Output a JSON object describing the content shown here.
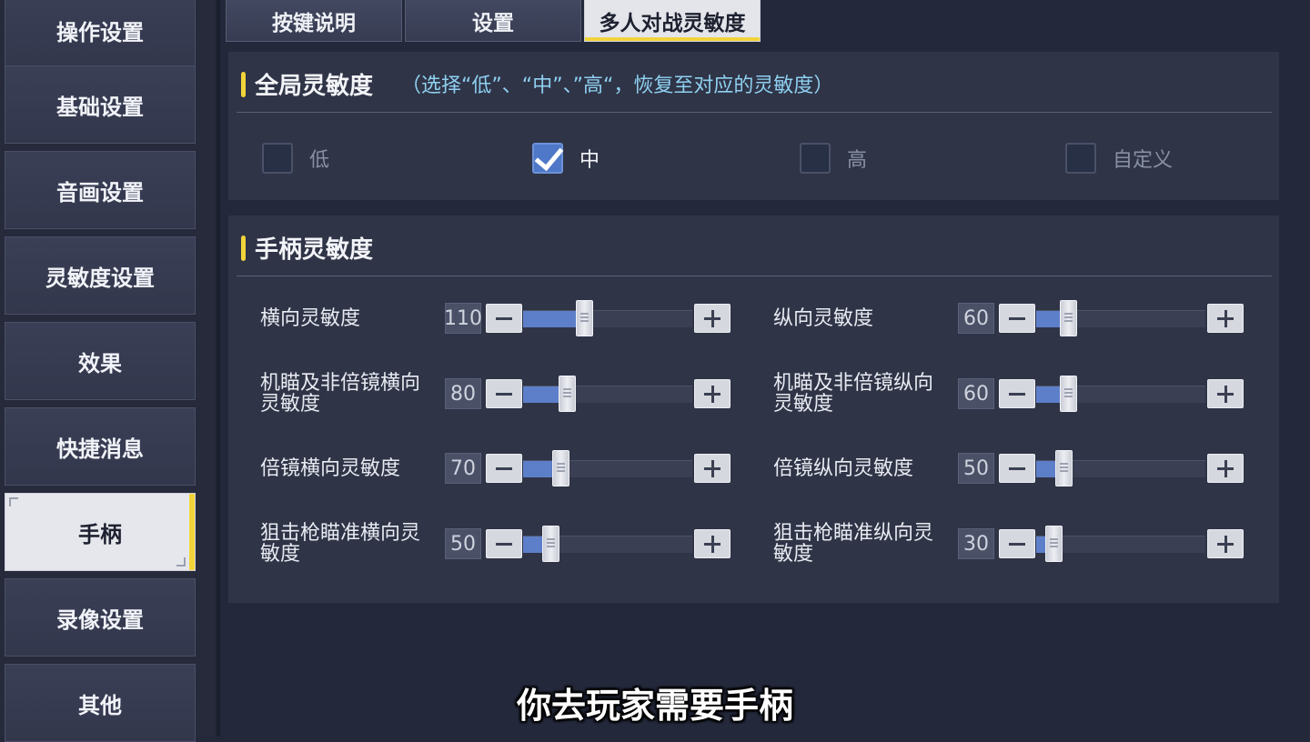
{
  "sidebar": {
    "items": [
      {
        "label": "操作设置",
        "active": false
      },
      {
        "label": "基础设置",
        "active": false
      },
      {
        "label": "音画设置",
        "active": false
      },
      {
        "label": "灵敏度设置",
        "active": false
      },
      {
        "label": "效果",
        "active": false
      },
      {
        "label": "快捷消息",
        "active": false
      },
      {
        "label": "手柄",
        "active": true
      },
      {
        "label": "录像设置",
        "active": false
      },
      {
        "label": "其他",
        "active": false
      }
    ]
  },
  "tabs": [
    {
      "label": "按键说明",
      "active": false
    },
    {
      "label": "设置",
      "active": false
    },
    {
      "label": "多人对战灵敏度",
      "active": true
    }
  ],
  "global_sensitivity": {
    "title": "全局灵敏度",
    "hint": "（选择“低”、“中”、”高“，恢复至对应的灵敏度）",
    "options": [
      {
        "label": "低",
        "checked": false
      },
      {
        "label": "中",
        "checked": true
      },
      {
        "label": "高",
        "checked": false
      },
      {
        "label": "自定义",
        "checked": false
      }
    ]
  },
  "controller_sensitivity": {
    "title": "手柄灵敏度",
    "left": [
      {
        "label": "横向灵敏度",
        "value": "110",
        "fill_fraction": 0.36
      },
      {
        "label": "机瞄及非倍镜横向灵敏度",
        "value": "80",
        "fill_fraction": 0.26
      },
      {
        "label": "倍镜横向灵敏度",
        "value": "70",
        "fill_fraction": 0.22
      },
      {
        "label": "狙击枪瞄准横向灵敏度",
        "value": "50",
        "fill_fraction": 0.16
      }
    ],
    "right": [
      {
        "label": "纵向灵敏度",
        "value": "60",
        "fill_fraction": 0.19
      },
      {
        "label": "机瞄及非倍镜纵向灵敏度",
        "value": "60",
        "fill_fraction": 0.19
      },
      {
        "label": "倍镜纵向灵敏度",
        "value": "50",
        "fill_fraction": 0.16
      },
      {
        "label": "狙击枪瞄准纵向灵敏度",
        "value": "30",
        "fill_fraction": 0.1
      }
    ]
  },
  "subtitle": "你去玩家需要手柄",
  "colors": {
    "accent": "#f2d43a",
    "slider_fill": "#5d7fc9",
    "hint": "#8fd0f0",
    "checkbox_on": "#4f78c8"
  }
}
